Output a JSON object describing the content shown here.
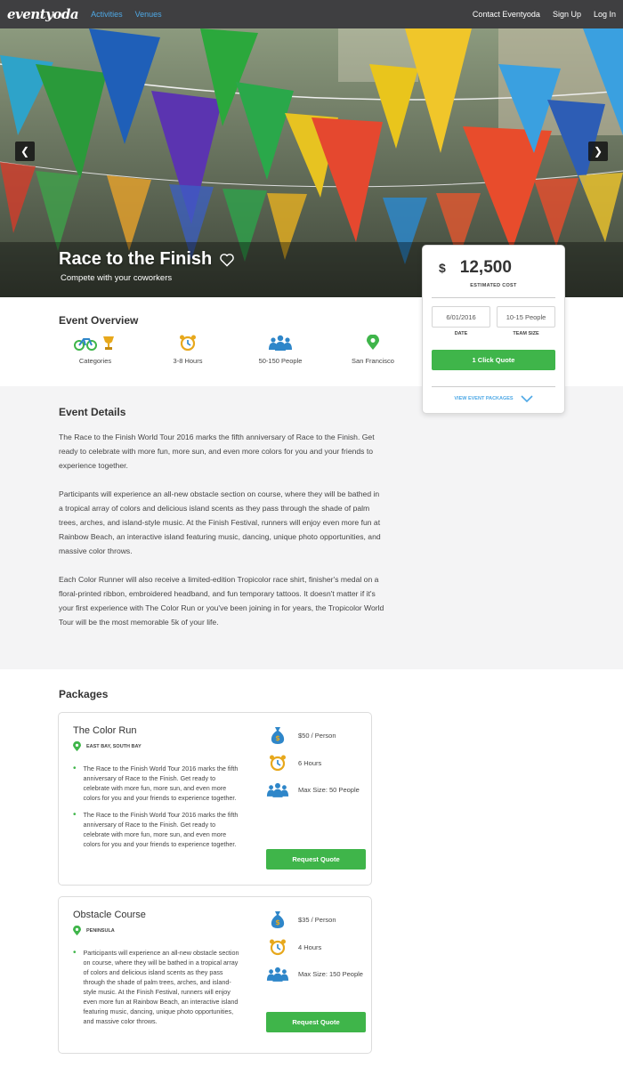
{
  "nav": {
    "logo": "eventyoda",
    "links": [
      "Activities",
      "Venues"
    ],
    "right_links": [
      "Contact Eventyoda",
      "Sign Up",
      "Log In"
    ]
  },
  "hero": {
    "title": "Race to the Finish",
    "subtitle": "Compete with your coworkers",
    "prev_icon": "chevron-left-icon",
    "next_icon": "chevron-right-icon",
    "favorite_icon": "heart-outline-icon"
  },
  "overview": {
    "heading": "Event Overview",
    "items": [
      {
        "icon": "bike-trophy-icon",
        "label": "Categories"
      },
      {
        "icon": "alarm-clock-icon",
        "label": "3-8 Hours"
      },
      {
        "icon": "people-group-icon",
        "label": "50-150 People"
      },
      {
        "icon": "map-pin-icon",
        "label": "San Francisco"
      }
    ]
  },
  "cost_card": {
    "currency": "$",
    "amount": "12,500",
    "amount_label": "ESTIMATED COST",
    "date_value": "6/01/2016",
    "date_label": "DATE",
    "team_value": "10-15 People",
    "team_label": "TEAM SIZE",
    "quote_button": "1 Click Quote",
    "view_packages": "VIEW EVENT PACKAGES"
  },
  "details": {
    "heading": "Event Details",
    "paragraphs": [
      "The Race to the Finish World Tour 2016 marks the fifth anniversary of Race to the Finish. Get ready to celebrate with more fun, more sun, and even more colors for you and your friends to experience together.",
      "Participants will experience an all-new obstacle section on course, where they will be bathed in a tropical array of colors and delicious island scents as they pass through the shade of palm trees, arches, and island-style music. At the Finish Festival, runners will enjoy even more fun at Rainbow Beach, an interactive island featuring music, dancing, unique photo opportunities, and massive color throws.",
      "Each Color Runner will also receive a limited-edition Tropicolor race shirt, finisher's medal on a floral-printed ribbon, embroidered headband, and fun temporary tattoos. It doesn't matter if it's your first experience with The Color Run or you've been joining in for years, the Tropicolor World Tour will be the most memorable 5k of your life."
    ]
  },
  "packages": {
    "heading": "Packages",
    "items": [
      {
        "title": "The Color Run",
        "location": "EAST BAY, SOUTH BAY",
        "bullets": [
          "The Race to the Finish World Tour 2016 marks the fifth anniversary of Race to the Finish. Get ready to celebrate with more fun, more sun, and even more colors for you and your friends to experience together.",
          "The Race to the Finish World Tour 2016 marks the fifth anniversary of Race to the Finish. Get ready to celebrate with more fun, more sun, and even more colors for you and your friends to experience together."
        ],
        "price": "$50 / Person",
        "duration": "6 Hours",
        "size": "Max Size: 50 People",
        "button": "Request Quote"
      },
      {
        "title": "Obstacle Course",
        "location": "PENINSULA",
        "bullets": [
          "Participants will experience an all-new obstacle section on course, where they will be bathed in a tropical array of colors and delicious island scents as they pass through the shade of palm trees, arches, and island-style music. At the Finish Festival, runners will enjoy even more fun at Rainbow Beach, an interactive island featuring music, dancing, unique photo opportunities, and massive color throws."
        ],
        "price": "$35 / Person",
        "duration": "4 Hours",
        "size": "Max Size: 150 People",
        "button": "Request Quote"
      }
    ]
  },
  "colors": {
    "nav_bg": "#3f3f41",
    "link_blue": "#4fa9e6",
    "accent_green": "#3fb54a",
    "details_bg": "#f4f4f5",
    "icon_blue": "#2e86c9",
    "icon_gold": "#e7a81c"
  }
}
